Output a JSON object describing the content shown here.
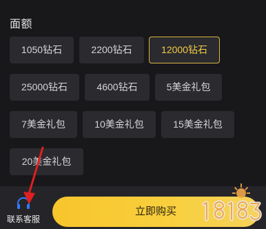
{
  "section": {
    "title": "面额"
  },
  "options": [
    {
      "label": "1050钻石",
      "selected": false
    },
    {
      "label": "2200钻石",
      "selected": false
    },
    {
      "label": "12000钻石",
      "selected": true
    },
    {
      "label": "25000钻石",
      "selected": false
    },
    {
      "label": "4600钻石",
      "selected": false
    },
    {
      "label": "5美金礼包",
      "selected": false
    },
    {
      "label": "7美金礼包",
      "selected": false
    },
    {
      "label": "10美金礼包",
      "selected": false
    },
    {
      "label": "15美金礼包",
      "selected": false
    },
    {
      "label": "20美金礼包",
      "selected": false
    }
  ],
  "bottom": {
    "customer_service_label": "联系客服",
    "customer_service_icon": "headset-icon",
    "buy_label": "立即购买"
  },
  "watermark": {
    "text": "18183"
  },
  "colors": {
    "background": "#18181b",
    "option_bg": "#2a2a2f",
    "accent": "#f2cc46",
    "annotation_arrow": "#e02020"
  }
}
